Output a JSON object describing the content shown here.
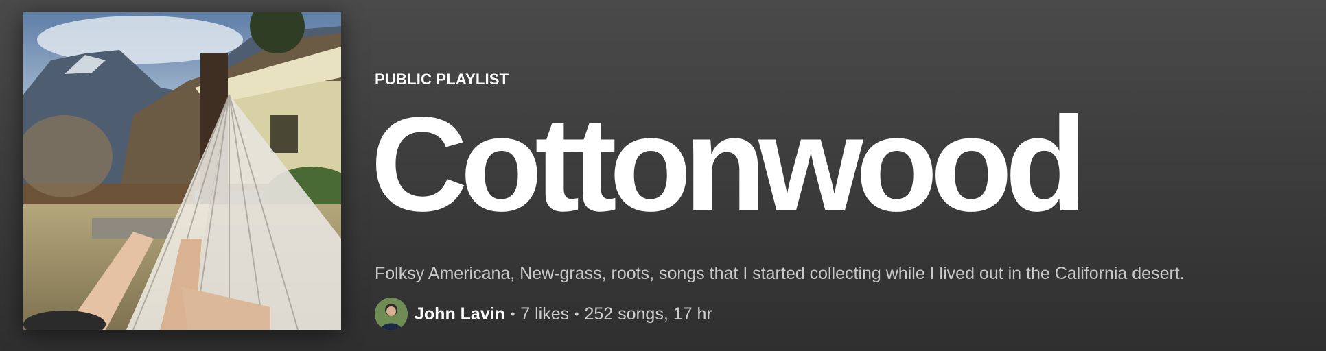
{
  "playlist": {
    "type_label": "PUBLIC PLAYLIST",
    "title": "Cottonwood",
    "description": "Folksy Americana, New-grass, roots, songs that I started collecting while I lived out in the California desert.",
    "owner": "John Lavin",
    "likes": "7 likes",
    "songs_duration": "252 songs, 17 hr",
    "separator": "•"
  },
  "colors": {
    "background": "#3d3d3d",
    "title": "#ffffff",
    "subtext": "#c9c9c9"
  },
  "icons": {
    "cover": "playlist-cover-image",
    "avatar": "owner-avatar-image"
  }
}
